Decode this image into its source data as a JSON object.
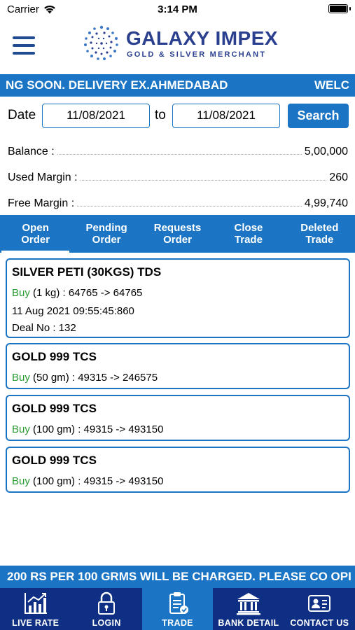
{
  "status_bar": {
    "carrier": "Carrier",
    "time": "3:14 PM"
  },
  "header": {
    "logo_title": "GALAXY IMPEX",
    "logo_subtitle": "GOLD & SILVER MERCHANT",
    "menu_icon": "hamburger-menu-icon"
  },
  "ticker_top": {
    "left": "NG SOON. DELIVERY EX.AHMEDABAD",
    "right": "WELC"
  },
  "date_filter": {
    "date_label": "Date",
    "from_value": "11/08/2021",
    "to_label": "to",
    "to_value": "11/08/2021",
    "search_label": "Search"
  },
  "summary": {
    "balance_label": "Balance :",
    "balance_value": "5,00,000",
    "used_margin_label": "Used Margin :",
    "used_margin_value": "260",
    "free_margin_label": "Free Margin :",
    "free_margin_value": "4,99,740"
  },
  "tabs": [
    {
      "line1": "Open",
      "line2": "Order",
      "active": true
    },
    {
      "line1": "Pending",
      "line2": "Order",
      "active": false
    },
    {
      "line1": "Requests",
      "line2": "Order",
      "active": false
    },
    {
      "line1": "Close",
      "line2": "Trade",
      "active": false
    },
    {
      "line1": "Deleted",
      "line2": "Trade",
      "active": false
    }
  ],
  "orders": [
    {
      "title": "SILVER PETI (30KGS) TDS",
      "side": "Buy",
      "detail": " (1 kg) : 64765 -> 64765",
      "timestamp": "11 Aug 2021 09:55:45:860",
      "deal_no": "Deal No : 132"
    },
    {
      "title": "GOLD 999 TCS",
      "side": "Buy",
      "detail": " (50 gm) : 49315 -> 246575"
    },
    {
      "title": "GOLD 999 TCS",
      "side": "Buy",
      "detail": " (100 gm) : 49315 -> 493150"
    },
    {
      "title": "GOLD 999 TCS",
      "side": "Buy",
      "detail": " (100 gm) : 49315 -> 493150"
    }
  ],
  "ticker_bottom": {
    "text": "200 RS PER 100 GRMS WILL BE CHARGED. PLEASE CO OPI"
  },
  "bottom_nav": [
    {
      "label": "LIVE RATE",
      "icon": "bar-chart-icon",
      "active": false
    },
    {
      "label": "LOGIN",
      "icon": "lock-icon",
      "active": false
    },
    {
      "label": "TRADE",
      "icon": "clipboard-icon",
      "active": true
    },
    {
      "label": "BANK DETAIL",
      "icon": "bank-icon",
      "active": false
    },
    {
      "label": "CONTACT US",
      "icon": "contact-card-icon",
      "active": false
    }
  ],
  "colors": {
    "primary_blue": "#1b75c4",
    "nav_dark_blue": "#0e2f84",
    "logo_blue": "#2b3f8f",
    "buy_green": "#2a9a32"
  }
}
